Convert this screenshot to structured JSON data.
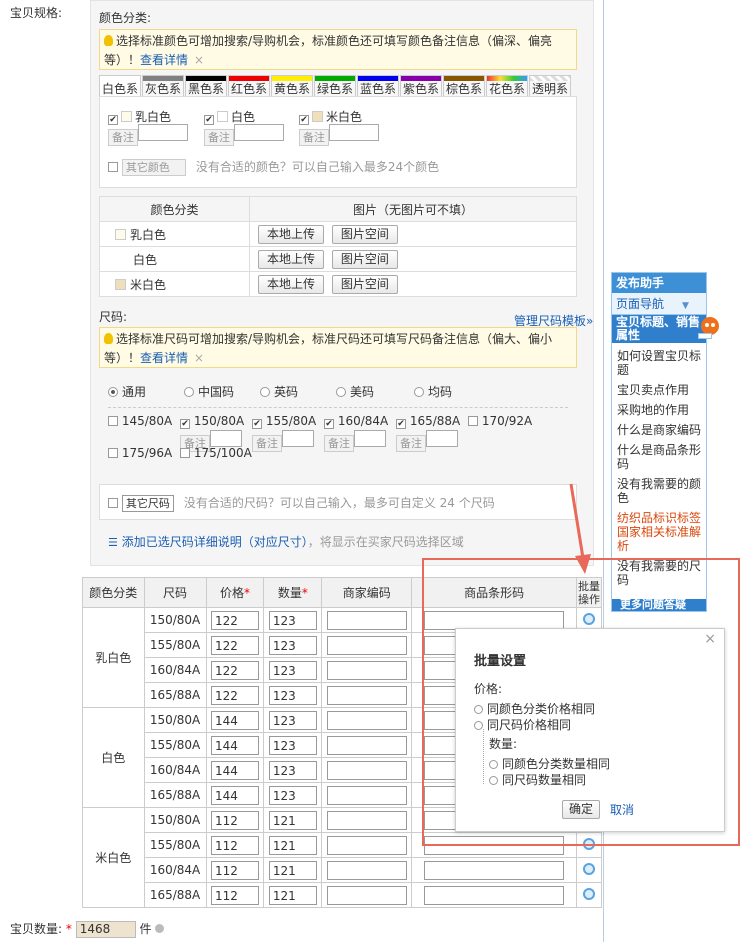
{
  "labels": {
    "spec": "宝贝规格:",
    "qty": "宝贝数量:",
    "qty_unit": "件",
    "required_star": "*"
  },
  "color": {
    "title": "颜色分类:",
    "tip": "选择标准颜色可增加搜索/导购机会，标准颜色还可填写颜色备注信息（偏深、偏亮等）！",
    "tip_link": "查看详情",
    "tabs": [
      {
        "label": "白色系",
        "color": "#ffffff"
      },
      {
        "label": "灰色系",
        "color": "#808080"
      },
      {
        "label": "黑色系",
        "color": "#000000"
      },
      {
        "label": "红色系",
        "color": "#ee0000"
      },
      {
        "label": "黄色系",
        "color": "#ffee00"
      },
      {
        "label": "绿色系",
        "color": "#00aa00"
      },
      {
        "label": "蓝色系",
        "color": "#0000ee"
      },
      {
        "label": "紫色系",
        "color": "#8800aa"
      },
      {
        "label": "棕色系",
        "color": "#885500"
      },
      {
        "label": "花色系",
        "color": "#aaaaaa"
      },
      {
        "label": "透明系",
        "color": "#dddddd"
      }
    ],
    "options": [
      {
        "label": "乳白色",
        "swatch": "#fffbea",
        "checked": true
      },
      {
        "label": "白色",
        "swatch": "#ffffff",
        "checked": true
      },
      {
        "label": "米白色",
        "swatch": "#efe0bb",
        "checked": true
      }
    ],
    "note_placeholder": "备注",
    "other_placeholder": "其它颜色",
    "other_hint": "没有合适的颜色？可以自己输入最多24个颜色",
    "img_header": [
      "颜色分类",
      "图片（无图片可不填）"
    ],
    "img_rows": [
      "乳白色",
      "白色",
      "米白色"
    ],
    "btn_upload": "本地上传",
    "btn_space": "图片空间"
  },
  "size": {
    "title": "尺码:",
    "manage": "管理尺码模板»",
    "tip": "选择标准尺码可增加搜索/导购机会，标准尺码还可填写尺码备注信息（偏大、偏小等）！",
    "tip_link": "查看详情",
    "types": [
      "通用",
      "中国码",
      "英码",
      "美码",
      "均码"
    ],
    "options": [
      {
        "label": "145/80A",
        "checked": false
      },
      {
        "label": "150/80A",
        "checked": true
      },
      {
        "label": "155/80A",
        "checked": true
      },
      {
        "label": "160/84A",
        "checked": true
      },
      {
        "label": "165/88A",
        "checked": true
      },
      {
        "label": "170/92A",
        "checked": false
      },
      {
        "label": "175/96A",
        "checked": false
      },
      {
        "label": "175/100A",
        "checked": false
      }
    ],
    "note_placeholder": "备注",
    "other_placeholder": "其它尺码",
    "other_hint": "没有合适的尺码？可以自己输入，最多可自定义 24 个尺码",
    "add_link": "添加已选尺码详细说明（对应尺寸）",
    "add_hint": "，将显示在买家尺码选择区域"
  },
  "sku": {
    "headers": {
      "color": "颜色分类",
      "size": "尺码",
      "price": "价格",
      "qty": "数量",
      "code": "商家编码",
      "barcode": "商品条形码",
      "batch": "批量操作"
    },
    "groups": [
      {
        "color": "乳白色",
        "rows": [
          {
            "size": "150/80A",
            "price": "122",
            "qty": "123"
          },
          {
            "size": "155/80A",
            "price": "122",
            "qty": "123"
          },
          {
            "size": "160/84A",
            "price": "122",
            "qty": "123"
          },
          {
            "size": "165/88A",
            "price": "122",
            "qty": "123"
          }
        ]
      },
      {
        "color": "白色",
        "rows": [
          {
            "size": "150/80A",
            "price": "144",
            "qty": "123"
          },
          {
            "size": "155/80A",
            "price": "144",
            "qty": "123"
          },
          {
            "size": "160/84A",
            "price": "144",
            "qty": "123"
          },
          {
            "size": "165/88A",
            "price": "144",
            "qty": "123"
          }
        ]
      },
      {
        "color": "米白色",
        "rows": [
          {
            "size": "150/80A",
            "price": "112",
            "qty": "121"
          },
          {
            "size": "155/80A",
            "price": "112",
            "qty": "121"
          },
          {
            "size": "160/84A",
            "price": "112",
            "qty": "121"
          },
          {
            "size": "165/88A",
            "price": "112",
            "qty": "121"
          }
        ]
      }
    ]
  },
  "total_qty": "1468",
  "popup": {
    "title": "批量设置",
    "price_label": "价格:",
    "price_opt1": "同颜色分类价格相同",
    "price_opt2": "同尺码价格相同",
    "qty_label": "数量:",
    "qty_opt1": "同颜色分类数量相同",
    "qty_opt2": "同尺码数量相同",
    "confirm": "确定",
    "cancel": "取消",
    "close": "×"
  },
  "helper": {
    "title": "发布助手",
    "nav": "页面导航",
    "section": "宝贝标题、销售属性",
    "items": [
      "如何设置宝贝标题",
      "宝贝卖点作用",
      "采购地的作用",
      "什么是商家编码",
      "什么是商品条形码",
      "没有我需要的颜色",
      "纺织品标识标签国家相关标准解析",
      "没有我需要的尺码"
    ],
    "bottom": "更多问题答疑"
  }
}
